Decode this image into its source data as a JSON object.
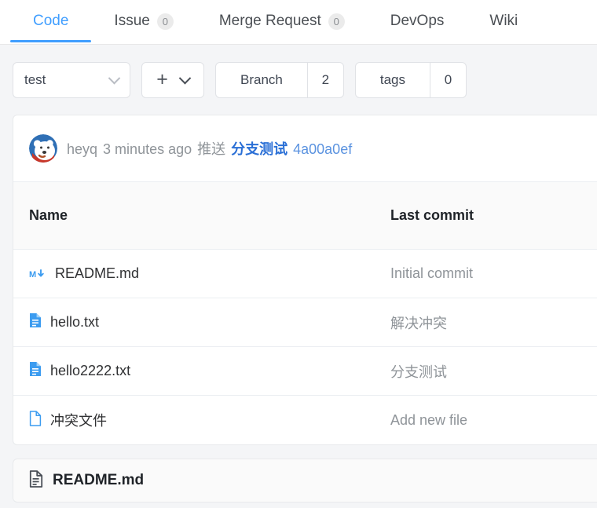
{
  "tabs": [
    {
      "label": "Code",
      "badge": null,
      "active": true,
      "name": "tab-code"
    },
    {
      "label": "Issue",
      "badge": "0",
      "active": false,
      "name": "tab-issue"
    },
    {
      "label": "Merge Request",
      "badge": "0",
      "active": false,
      "name": "tab-merge-request"
    },
    {
      "label": "DevOps",
      "badge": null,
      "active": false,
      "name": "tab-devops"
    },
    {
      "label": "Wiki",
      "badge": null,
      "active": false,
      "name": "tab-wiki"
    }
  ],
  "toolbar": {
    "branch_select_value": "test",
    "add_button_label": "+",
    "branch_label": "Branch",
    "branch_count": "2",
    "tags_label": "tags",
    "tags_count": "0"
  },
  "commit_bar": {
    "author": "heyq",
    "time": "3 minutes ago",
    "action": "推送",
    "message": "分支测试",
    "sha": "4a00a0ef"
  },
  "table": {
    "headers": {
      "name": "Name",
      "last_commit": "Last commit"
    },
    "rows": [
      {
        "name": "README.md",
        "icon": "markdown-icon",
        "last_commit": "Initial commit"
      },
      {
        "name": "hello.txt",
        "icon": "file-filled-icon",
        "last_commit": "解决冲突"
      },
      {
        "name": "hello2222.txt",
        "icon": "file-filled-icon",
        "last_commit": "分支测试"
      },
      {
        "name": "冲突文件",
        "icon": "file-outline-icon",
        "last_commit": "Add new file"
      }
    ]
  },
  "readme": {
    "title": "README.md"
  },
  "colors": {
    "accent": "#409eff",
    "link": "#2a6fd6",
    "sha": "#5b93e0",
    "muted": "#8f9499",
    "file_icon": "#3c9cf0",
    "page_bg": "#f4f5f7"
  }
}
